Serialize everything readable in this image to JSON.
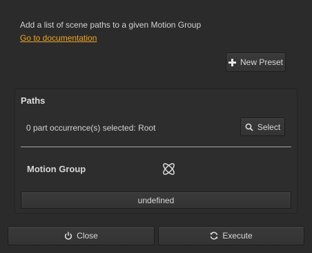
{
  "description": "Add a list of scene paths to a given Motion Group",
  "doc_link": "Go to documentation",
  "toolbar": {
    "new_preset_label": "New Preset"
  },
  "paths": {
    "title": "Paths",
    "selection_text": "0 part occurrence(s) selected: Root",
    "select_label": "Select"
  },
  "motion_group": {
    "label": "Motion Group",
    "value": "undefined"
  },
  "footer": {
    "close_label": "Close",
    "execute_label": "Execute"
  },
  "colors": {
    "background": "#2b2b2b",
    "link": "#f0a422"
  },
  "icons": {
    "new_preset": "plus-icon",
    "select": "search-icon",
    "motion_group": "atom-icon",
    "close": "power-icon",
    "execute": "refresh-icon"
  }
}
